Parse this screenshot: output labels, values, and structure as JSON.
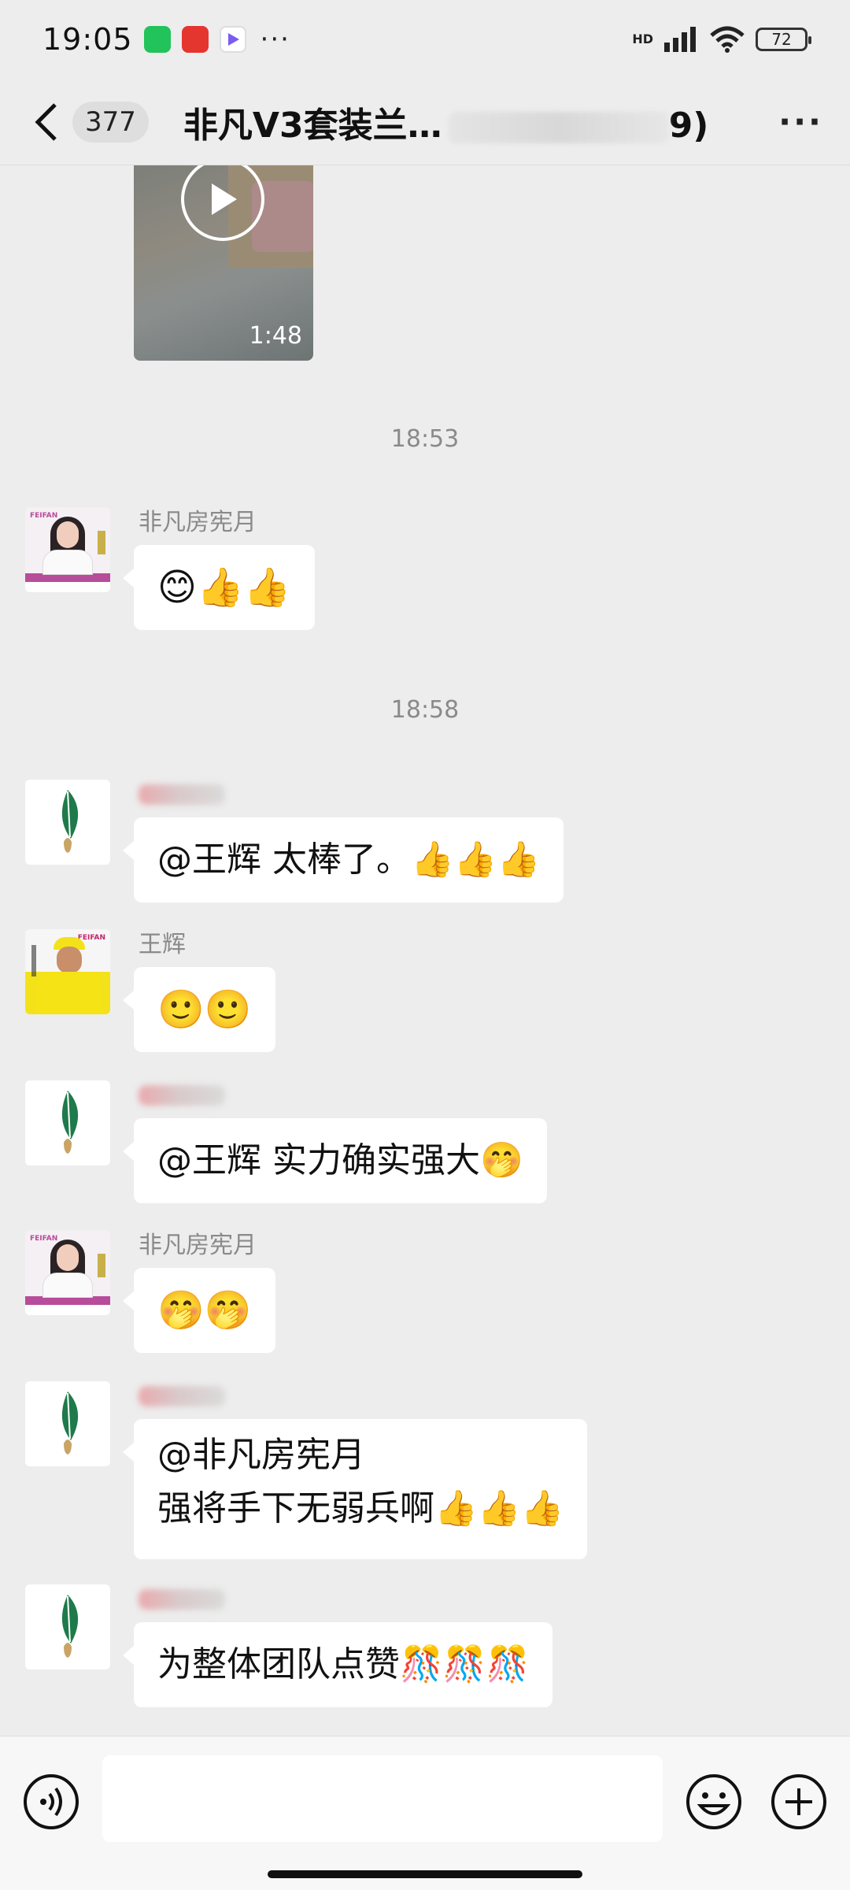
{
  "status_bar": {
    "time": "19:05",
    "network_label": "HD",
    "battery": "72",
    "more": "···"
  },
  "header": {
    "unread_count": "377",
    "title": "非凡V3套装兰…",
    "title_tail": "9)",
    "more": "···"
  },
  "video": {
    "duration": "1:48"
  },
  "timestamps": [
    "18:53",
    "18:58"
  ],
  "messages": [
    {
      "sender": "非凡房宪月",
      "avatar": "avatar-woman",
      "text": "😊👍👍"
    },
    {
      "sender": "",
      "avatar": "avatar-leaf",
      "text": "@王辉  太棒了。👍👍👍"
    },
    {
      "sender": "王辉",
      "avatar": "avatar-man",
      "text": "🙂🙂"
    },
    {
      "sender": "",
      "avatar": "avatar-leaf",
      "text": "@王辉  实力确实强大🤭"
    },
    {
      "sender": "非凡房宪月",
      "avatar": "avatar-woman",
      "text": "🤭🤭"
    },
    {
      "sender": "",
      "avatar": "avatar-leaf",
      "line1": "@非凡房宪月",
      "line2": "强将手下无弱兵啊👍👍👍"
    },
    {
      "sender": "",
      "avatar": "avatar-leaf",
      "text": "为整体团队点赞🎊🎊🎊"
    }
  ],
  "input": {
    "placeholder": ""
  },
  "colors": {
    "background": "#ededed",
    "bubble": "#ffffff",
    "meta_text": "#8a8a8a"
  }
}
